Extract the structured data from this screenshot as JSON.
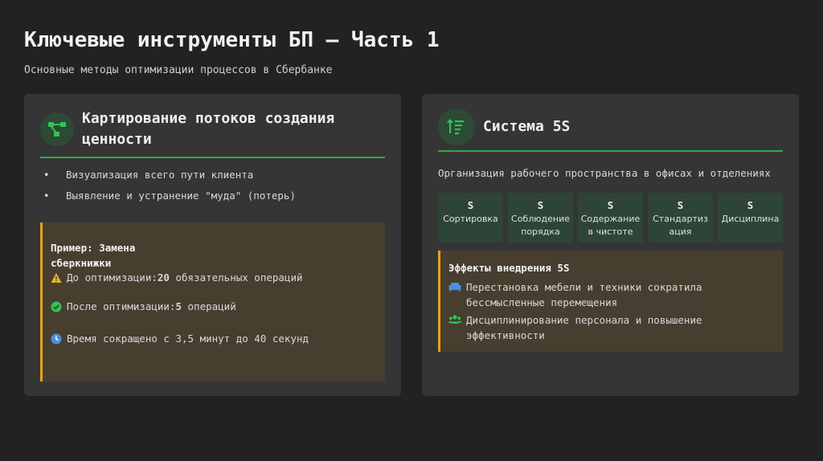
{
  "header": {
    "title": "Ключевые инструменты БП – Часть 1",
    "subtitle": "Основные методы оптимизации процессов в Сбербанке"
  },
  "colors": {
    "accent_green": "#33a845",
    "accent_orange": "#e8a21a",
    "warning_yellow": "#e8b824",
    "info_blue": "#4a90e2"
  },
  "left_card": {
    "icon": "flow-diagram-icon",
    "title": "Картирование потоков создания ценности",
    "bullets": [
      "Визуализация всего пути клиента",
      "Выявление и устранение \"муда\" (потерь)"
    ],
    "bullet_marker": "•",
    "example": {
      "title": "Пример: Замена сберкнижки",
      "rows": [
        {
          "icon": "warning-icon",
          "label": "До оптимизации:",
          "value": "20",
          "suffix": " обязательных операций"
        },
        {
          "icon": "check-circle-icon",
          "label": "После оптимизации:",
          "value": "5",
          "suffix": " операций"
        },
        {
          "icon": "clock-icon",
          "text": "Время сокращено с 3,5 минут до 40 секунд"
        }
      ]
    }
  },
  "right_card": {
    "icon": "sort-list-icon",
    "title": "Система 5S",
    "description": "Организация рабочего пространства в офисах и отделениях",
    "items": [
      {
        "letter": "S",
        "label": "Сортировка"
      },
      {
        "letter": "S",
        "label": "Соблюдение порядка"
      },
      {
        "letter": "S",
        "label": "Содержание в чистоте"
      },
      {
        "letter": "S",
        "label": "Стандартизация"
      },
      {
        "letter": "S",
        "label": "Дисциплина"
      }
    ],
    "effects": {
      "title": "Эффекты внедрения 5S",
      "rows": [
        {
          "icon": "sofa-icon",
          "text": "Перестановка мебели и техники сократила бессмысленные перемещения"
        },
        {
          "icon": "users-icon",
          "text": "Дисциплинирование персонала и повышение эффективности"
        }
      ]
    }
  }
}
